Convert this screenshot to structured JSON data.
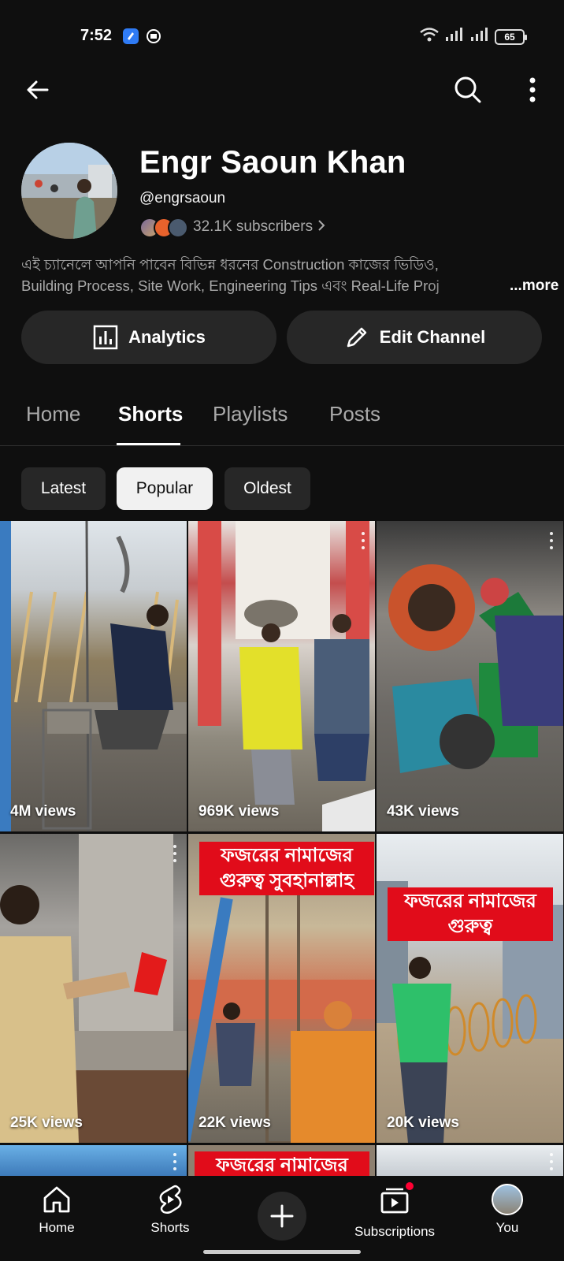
{
  "status_bar": {
    "time": "7:52",
    "battery": "65"
  },
  "channel": {
    "name": "Engr Saoun Khan",
    "handle": "@engrsaoun",
    "subscribers": "32.1K subscribers",
    "description_line1": "এই চ্যানেলে আপনি পাবেন বিভিন্ন ধরনের Construction কাজের ভিডিও,",
    "description_line2": "Building Process, Site Work, Engineering Tips এবং Real-Life Proj",
    "more": "...more"
  },
  "actions": {
    "analytics": "Analytics",
    "edit_channel": "Edit Channel"
  },
  "tabs": [
    {
      "label": "Home"
    },
    {
      "label": "Shorts"
    },
    {
      "label": "Playlists"
    },
    {
      "label": "Posts"
    }
  ],
  "active_tab": "Shorts",
  "chips": [
    {
      "label": "Latest"
    },
    {
      "label": "Popular"
    },
    {
      "label": "Oldest"
    }
  ],
  "selected_chip": "Popular",
  "shorts": [
    {
      "views": "4M views"
    },
    {
      "views": "969K views"
    },
    {
      "views": "43K views"
    },
    {
      "views": "25K views"
    },
    {
      "views": "22K views",
      "overlay": "ফজরের নামাজের গুরুত্ব সুবহানাল্লাহ"
    },
    {
      "views": "20K views",
      "overlay": "ফজরের নামাজের গুরুত্ব"
    },
    {
      "overlay": "ফজরের নামাজের গুরুত্ব"
    }
  ],
  "bottom_nav": [
    {
      "label": "Home"
    },
    {
      "label": "Shorts"
    },
    {
      "label": "Subscriptions"
    },
    {
      "label": "You"
    }
  ],
  "colors": {
    "background": "#0f0f0f",
    "surface": "#272727",
    "text_secondary": "#aaaaaa",
    "overlay_red": "#e10c1a",
    "notification": "#ff0033"
  }
}
